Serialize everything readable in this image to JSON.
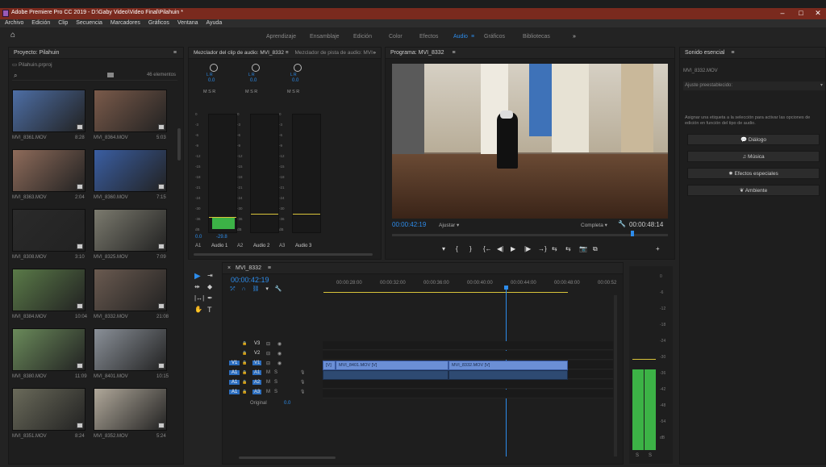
{
  "window": {
    "title": "Adobe Premiere Pro CC 2019 - D:\\Gaby Video\\Video Final\\Pilahuin *",
    "controls": [
      "–",
      "□",
      "✕"
    ]
  },
  "menu": [
    "Archivo",
    "Edición",
    "Clip",
    "Secuencia",
    "Marcadores",
    "Gráficos",
    "Ventana",
    "Ayuda"
  ],
  "workspaces": {
    "tabs": [
      "Aprendizaje",
      "Ensamblaje",
      "Edición",
      "Color",
      "Efectos",
      "Audio",
      "Gráficos",
      "Bibliotecas"
    ],
    "active": "Audio",
    "more": "»",
    "menu_glyph": "≡"
  },
  "project": {
    "title": "Proyecto: Pilahuin",
    "menu_glyph": "≡",
    "file": "Pilahuin.prproj",
    "search_placeholder": "",
    "count": "46 elementos",
    "items": [
      {
        "name": "MVI_8361.MOV",
        "dur": "8:28",
        "color": "#4d6ea5"
      },
      {
        "name": "MVI_8364.MOV",
        "dur": "5:03",
        "color": "#7a5a4a"
      },
      {
        "name": "MVI_8363.MOV",
        "dur": "2:04",
        "color": "#8e6b5a"
      },
      {
        "name": "MVI_8360.MOV",
        "dur": "7:15",
        "color": "#3a5ea2"
      },
      {
        "name": "MVI_8308.MOV",
        "dur": "3:10",
        "color": "#2a2a2a"
      },
      {
        "name": "MVI_8325.MOV",
        "dur": "7:09",
        "color": "#7b7a6e"
      },
      {
        "name": "MVI_8384.MOV",
        "dur": "10:04",
        "color": "#5a7a48"
      },
      {
        "name": "MVI_8332.MOV",
        "dur": "21:08",
        "color": "#6a5a50"
      },
      {
        "name": "MVI_8380.MOV",
        "dur": "11:09",
        "color": "#6a8a5a"
      },
      {
        "name": "MVI_8401.MOV",
        "dur": "10:15",
        "color": "#8a9098"
      },
      {
        "name": "MVI_8351.MOV",
        "dur": "8:24",
        "color": "#6a6a5a"
      },
      {
        "name": "MVI_8352.MOV",
        "dur": "5:24",
        "color": "#b0a89a"
      }
    ]
  },
  "mixer": {
    "tab_active": "Mezclador del clip de audio: MVI_8332",
    "tab_other": "Mezclador de pista de audio: MVI",
    "menu_glyph": "≡",
    "more": "»",
    "pan_values": [
      "0.0",
      "0.0",
      "0.0"
    ],
    "pan_labels": [
      "L  R",
      "L  R",
      "L  R"
    ],
    "msr": "M  S  R",
    "db_scale": [
      "0",
      "-3",
      "-6",
      "-9",
      "-12",
      "-15",
      "-18",
      "-21",
      "-24",
      "-30",
      "-36",
      "dB"
    ],
    "level_value": "-29.8",
    "left_value": "0.0",
    "channels": [
      {
        "id": "A1",
        "name": "Audio 1"
      },
      {
        "id": "A2",
        "name": "Audio 2"
      },
      {
        "id": "A3",
        "name": "Audio 3"
      }
    ]
  },
  "program": {
    "title": "Programa: MVI_8332",
    "menu_glyph": "≡",
    "timecode": "00:00:42:19",
    "fit": "Ajustar",
    "resolution": "Completa",
    "duration": "00:00:48:14",
    "controls": [
      "▾",
      "{",
      "}",
      "{←",
      "◀|",
      "▶",
      "|▶",
      "→}",
      "⇆",
      "⇆",
      "📷",
      "⧉",
      "+"
    ]
  },
  "essential_sound": {
    "title": "Sonido esencial",
    "menu_glyph": "≡",
    "clip": "MVI_8332.MOV",
    "preset_label": "Ajuste preestablecido:",
    "hint": "Asignar una etiqueta a la selección para activar las opciones de edición en función del tipo de audio.",
    "buttons": [
      {
        "label": "Diálogo",
        "icon": "speech-icon"
      },
      {
        "label": "Música",
        "icon": "music-icon"
      },
      {
        "label": "Efectos especiales",
        "icon": "sparkle-icon"
      },
      {
        "label": "Ambiente",
        "icon": "ambience-icon"
      }
    ]
  },
  "timeline": {
    "close": "×",
    "sequence": "MVI_8332",
    "menu_glyph": "≡",
    "timecode": "00:00:42:19",
    "ruler": [
      "00:00:28:00",
      "00:00:32:00",
      "00:00:36:00",
      "00:00:40:00",
      "00:00:44:00",
      "00:00:48:00",
      "00:00:52"
    ],
    "video_tracks": [
      "V3",
      "V2",
      "V1"
    ],
    "audio_tracks": [
      "A1",
      "A2",
      "A3"
    ],
    "track_buttons": "M   S",
    "master": "Original",
    "master_value": "0.0",
    "clip_v1_a": "MVI_8401.MOV [V]",
    "clip_v1_b": "MVI_8332.MOV [V]",
    "clip_v1_stub": "[V]"
  },
  "meter": {
    "scale": [
      "0",
      "-6",
      "-12",
      "-18",
      "-24",
      "-30",
      "-36",
      "-42",
      "-48",
      "-54",
      "dB"
    ],
    "footer": [
      "S",
      "S"
    ]
  },
  "colors": {
    "accent": "#2d8ceb",
    "clip_video": "#6b8fd6",
    "meter_green": "#3cb246",
    "title_red": "#7a2a1e"
  }
}
